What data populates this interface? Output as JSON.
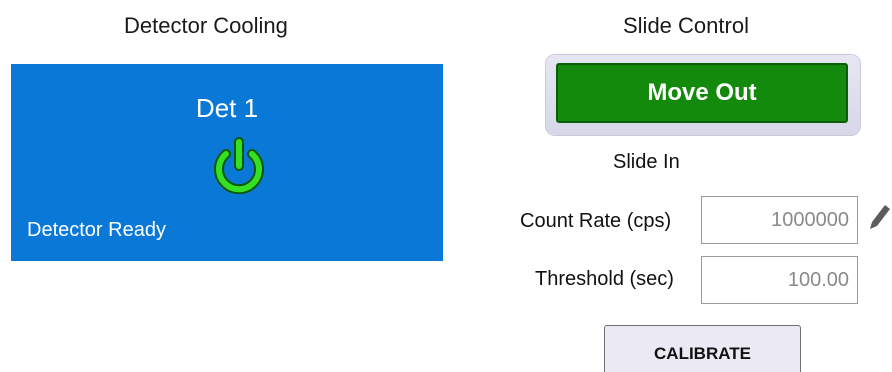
{
  "detector_cooling": {
    "title": "Detector Cooling",
    "tile": {
      "name": "Det 1",
      "status": "Detector Ready",
      "icon": "power-icon",
      "color": "#0a78d7",
      "icon_color": "#35e024"
    }
  },
  "slide_control": {
    "title": "Slide Control",
    "move_button_label": "Move Out",
    "move_button_color": "#138a0c",
    "state": "Slide In",
    "count_rate": {
      "label": "Count Rate (cps)",
      "value": "1000000"
    },
    "threshold": {
      "label": "Threshold (sec)",
      "value": "100.00"
    },
    "edit_icon": "pencil-icon",
    "calibrate_label": "CALIBRATE"
  }
}
